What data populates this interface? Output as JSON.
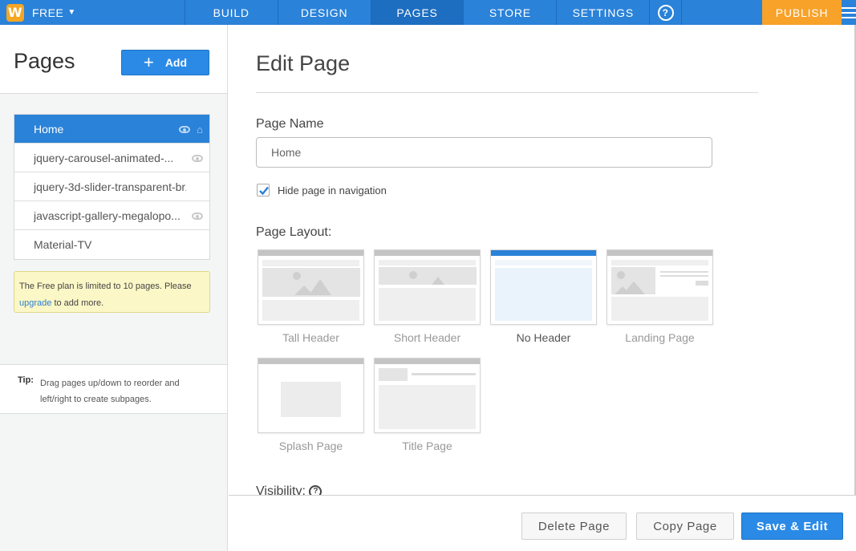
{
  "topbar": {
    "brand_letter": "W",
    "plan_label": "FREE",
    "nav": [
      "BUILD",
      "DESIGN",
      "PAGES",
      "STORE",
      "SETTINGS"
    ],
    "active_nav": "PAGES",
    "help_glyph": "?",
    "publish_label": "PUBLISH",
    "colors": {
      "bar": "#2a82d9",
      "active": "#1d6dc0",
      "publish": "#f8a22a"
    }
  },
  "sidebar": {
    "title": "Pages",
    "add_label": "Add",
    "pages": [
      {
        "name": "Home",
        "selected": true,
        "hidden_icon": "eye-icon",
        "home_icon": "home-icon"
      },
      {
        "name": "jquery-carousel-animated-...",
        "hidden_icon": "eye-icon"
      },
      {
        "name": "jquery-3d-slider-transparent-br..."
      },
      {
        "name": "javascript-gallery-megalopo...",
        "hidden_icon": "eye-icon"
      },
      {
        "name": "Material-TV"
      }
    ],
    "notice": {
      "before_link": "The Free plan is limited to 10 pages. Please",
      "link": "upgrade",
      "after_link": "to add more."
    },
    "tip": {
      "label": "Tip:",
      "text": "Drag pages up/down to reorder and left/right to create subpages."
    }
  },
  "main": {
    "title": "Edit Page",
    "page_name_label": "Page Name",
    "page_name_value": "Home",
    "hide_in_nav_label": "Hide page in navigation",
    "hide_in_nav_checked": true,
    "layout_label": "Page Layout:",
    "layouts": [
      "Tall Header",
      "Short Header",
      "No Header",
      "Landing Page",
      "Splash Page",
      "Title Page"
    ],
    "selected_layout": "No Header",
    "visibility_label": "Visibility:",
    "visibility_help_icon": "help-icon"
  },
  "footer": {
    "delete_label": "Delete Page",
    "copy_label": "Copy Page",
    "save_label": "Save & Edit"
  }
}
